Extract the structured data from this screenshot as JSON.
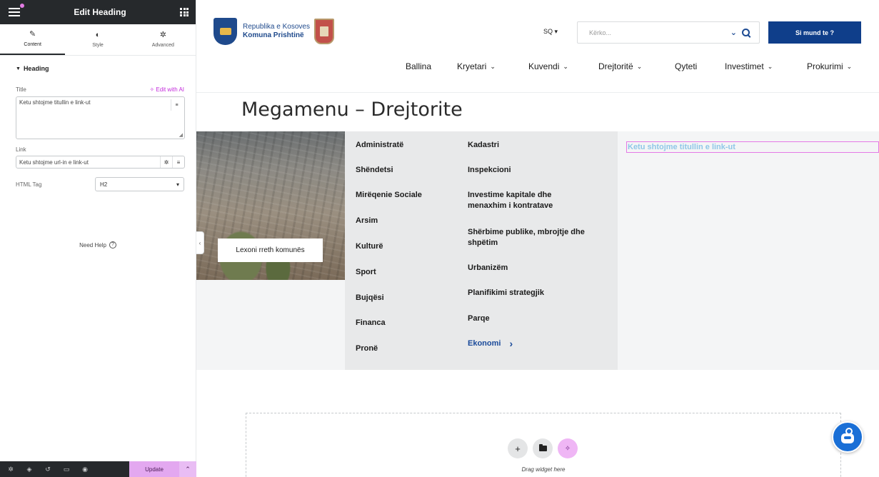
{
  "panel": {
    "title": "Edit Heading",
    "tabs": [
      {
        "label": "Content",
        "icon": "pencil-icon"
      },
      {
        "label": "Style",
        "icon": "contrast-icon"
      },
      {
        "label": "Advanced",
        "icon": "gear-icon"
      }
    ],
    "section": "Heading",
    "title_label": "Title",
    "ai_link": "Edit with AI",
    "title_value": "Ketu shtojme titullin e link-ut",
    "link_label": "Link",
    "link_value": "Ketu shtojme url-in e link-ut",
    "html_tag_label": "HTML Tag",
    "html_tag_value": "H2",
    "need_help": "Need Help",
    "update": "Update",
    "accent_color": "#e3a8f0"
  },
  "site": {
    "logo_line1": "Republika e Kosoves",
    "logo_line2": "Komuna Prishtinë",
    "lang": "SQ ▾",
    "search_placeholder": "Kërko...",
    "cta": "Si mund te ?",
    "nav": [
      "Ballina",
      "Kryetari",
      "Kuvendi",
      "Drejtoritë",
      "Qyteti",
      "Investimet",
      "Prokurimi"
    ],
    "page_title": "Megamenu – Drejtorite",
    "image_button": "Lexoni rreth komunës",
    "col1": [
      "Administratë",
      "Shëndetsi",
      "Mirëqenie Sociale",
      "Arsim",
      "Kulturë",
      "Sport",
      "Bujqësi",
      "Financa",
      "Pronë"
    ],
    "col2": [
      "Kadastri",
      "Inspekcioni",
      "Investime kapitale dhe menaxhim i kontratave",
      "Shërbime publike, mbrojtje dhe shpëtim",
      "Urbanizëm",
      "Planifikimi strategjik",
      "Parqe",
      "Ekonomi"
    ],
    "edited_heading": "Ketu shtojme titullin e link-ut",
    "drop_text": "Drag widget here",
    "brand_color": "#0f3e8a"
  }
}
